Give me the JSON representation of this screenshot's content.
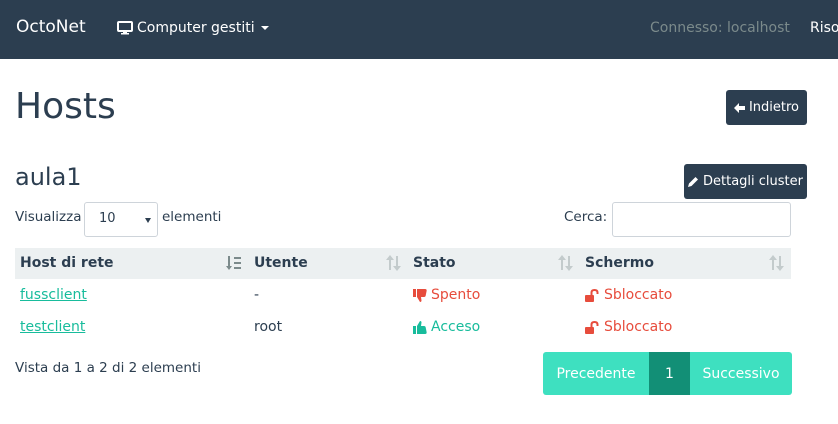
{
  "navbar": {
    "brand": "OctoNet",
    "menu_label": "Computer gestiti",
    "status": "Connesso: localhost",
    "right_label": "Riso"
  },
  "page": {
    "title": "Hosts",
    "back_label": "Indietro",
    "cluster_name": "aula1",
    "cluster_details_label": "Dettagli cluster"
  },
  "table_controls": {
    "show_label": "Visualizza",
    "page_size": "10",
    "entries_label": "elementi",
    "search_label": "Cerca:",
    "search_value": ""
  },
  "table": {
    "columns": [
      "Host di rete",
      "Utente",
      "Stato",
      "Schermo"
    ],
    "rows": [
      {
        "host": "fussclient",
        "user": "-",
        "status": "Spento",
        "status_icon": "thumbs-down-icon",
        "screen": "Sbloccato",
        "screen_icon": "unlock-icon"
      },
      {
        "host": "testclient",
        "user": "root",
        "status": "Acceso",
        "status_icon": "thumbs-up-icon",
        "screen": "Sbloccato",
        "screen_icon": "unlock-icon"
      }
    ]
  },
  "footer": {
    "info": "Vista da 1 a 2 di 2 elementi",
    "prev_label": "Precedente",
    "current_page": "1",
    "next_label": "Successivo"
  },
  "colors": {
    "navbar": "#2c3e50",
    "accent": "#18bc9c",
    "danger": "#e74c3c",
    "pager_light": "#3ee0c0",
    "pager_active": "#128f76"
  }
}
